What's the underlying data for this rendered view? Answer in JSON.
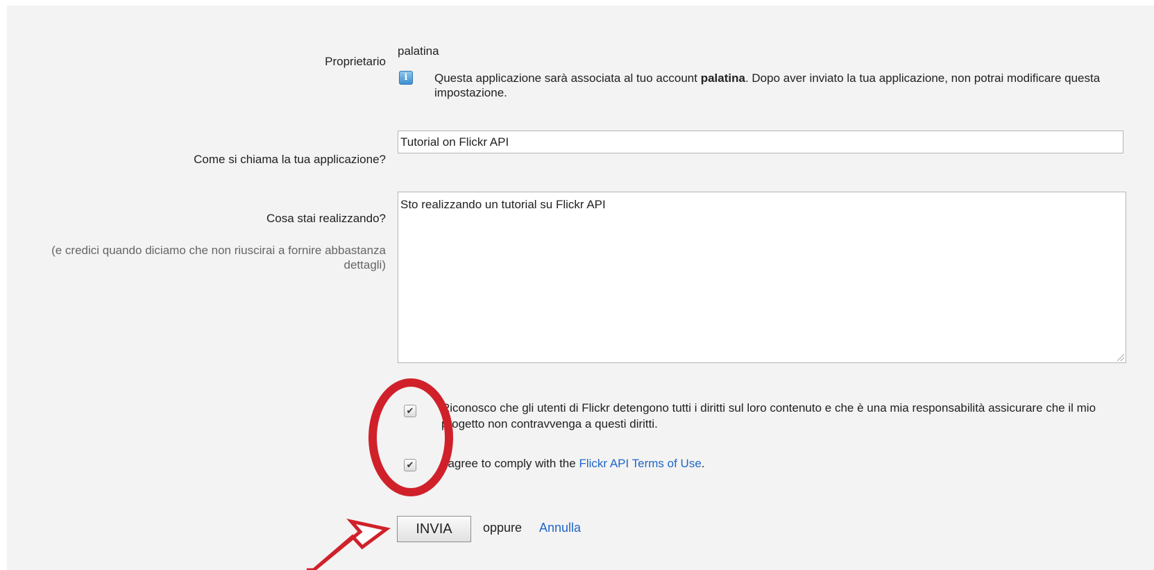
{
  "owner": {
    "label": "Proprietario",
    "username": "palatina",
    "info_prefix": "Questa applicazione sarà associata al tuo account ",
    "info_bold": "palatina",
    "info_suffix": ". Dopo aver inviato la tua applicazione, non potrai modificare questa impostazione.",
    "icon": "info-icon"
  },
  "app_name": {
    "label": "Come si chiama la tua applicazione?",
    "value": "Tutorial on Flickr API"
  },
  "description": {
    "label": "Cosa stai realizzando?",
    "hint": "(e credici quando diciamo che non riuscirai a fornire abbastanza dettagli)",
    "value": "Sto realizzando un tutorial su Flickr API"
  },
  "agreements": {
    "rights_text": "Riconosco che gli utenti di Flickr detengono tutti i diritti sul loro contenuto e che è una mia responsabilità assicurare che il mio progetto non contravvenga a questi diritti.",
    "rights_checked": true,
    "terms_prefix": "I agree to comply with the ",
    "terms_link": "Flickr API Terms of Use",
    "terms_suffix": ".",
    "terms_checked": true
  },
  "actions": {
    "submit_label": "INVIA",
    "or_label": "oppure",
    "cancel_label": "Annulla"
  },
  "annotation": {
    "color": "#d0212a"
  }
}
